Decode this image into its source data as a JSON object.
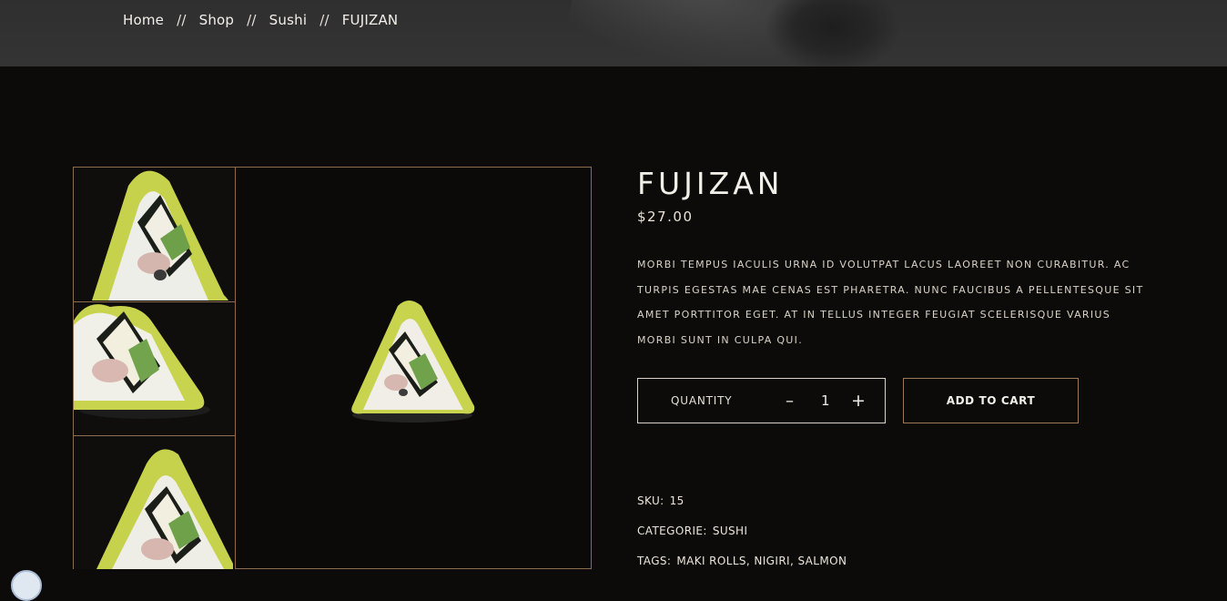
{
  "breadcrumb": {
    "items": [
      "Home",
      "Shop",
      "Sushi",
      "FUJIZAN"
    ],
    "separator": "//"
  },
  "product": {
    "title": "FUJIZAN",
    "price": "$27.00",
    "description": "MORBI TEMPUS IACULIS URNA ID VOLUTPAT LACUS LAOREET NON CURABITUR. AC TURPIS EGESTAS MAE CENAS EST PHARETRA. NUNC FAUCIBUS A PELLENTESQUE SIT AMET PORTTITOR EGET. AT IN TELLUS INTEGER FEUGIAT SCELERISQUE VARIUS MORBI SUNT IN CULPA QUI."
  },
  "quantity": {
    "label": "QUANTITY",
    "minus": "–",
    "value": "1",
    "plus": "+"
  },
  "cart": {
    "label": "ADD TO CART"
  },
  "meta": {
    "sku_label": "SKU:",
    "sku_value": "15",
    "category_label": "CATEGORIE:",
    "category_value": "SUSHI",
    "tags_label": "TAGS:",
    "tags": [
      "MAKI ROLLS",
      "NIGIRI",
      "SALMON"
    ],
    "tag_separator": ", "
  },
  "colors": {
    "background": "#0d0b09",
    "accent_border": "#8c6d4f",
    "hero": "#333333"
  }
}
